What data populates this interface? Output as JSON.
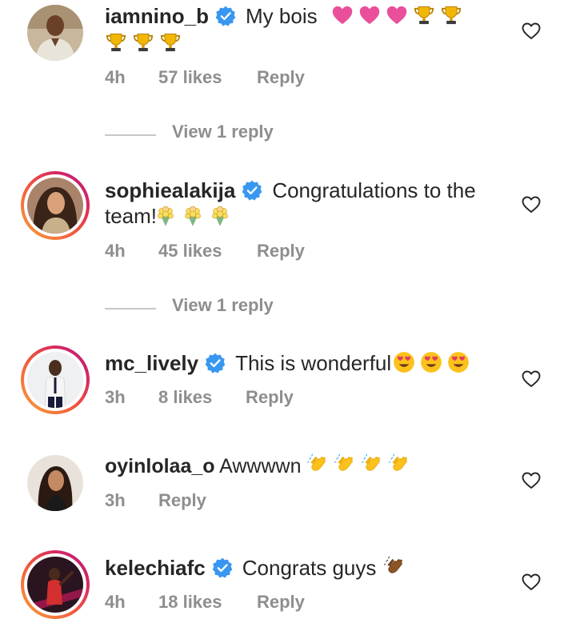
{
  "comments": [
    {
      "username": "iamnino_b",
      "verified": true,
      "text": "My bois",
      "emojis": [
        "pink-heart",
        "pink-heart",
        "pink-heart",
        "trophy",
        "trophy",
        "trophy",
        "trophy",
        "trophy"
      ],
      "time": "4h",
      "likes": "57 likes",
      "reply": "Reply",
      "view_replies": "View 1 reply"
    },
    {
      "username": "sophiealakija",
      "verified": true,
      "text": "Congratulations to the team!",
      "emojis": [
        "bouquet",
        "bouquet",
        "bouquet"
      ],
      "time": "4h",
      "likes": "45 likes",
      "reply": "Reply",
      "view_replies": "View 1 reply"
    },
    {
      "username": "mc_lively",
      "verified": true,
      "text": "This is wonderful",
      "emojis": [
        "heart-eyes",
        "heart-eyes",
        "heart-eyes"
      ],
      "time": "3h",
      "likes": "8 likes",
      "reply": "Reply"
    },
    {
      "username": "oyinlolaa_o",
      "verified": false,
      "text": "Awwwwn",
      "emojis": [
        "clapping-hands",
        "clapping-hands",
        "clapping-hands",
        "clapping-hands"
      ],
      "time": "3h",
      "reply": "Reply"
    },
    {
      "username": "kelechiafc",
      "verified": true,
      "text": "Congrats guys",
      "emojis": [
        "clapping-hands-dark"
      ],
      "time": "4h",
      "likes": "18 likes",
      "reply": "Reply"
    }
  ],
  "colors": {
    "text": "#262626",
    "muted": "#8e8e8e",
    "verified": "#3897f0",
    "story_ring": "#d8275f"
  }
}
